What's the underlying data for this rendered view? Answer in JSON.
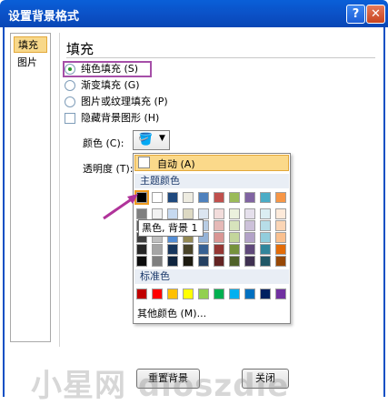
{
  "window": {
    "title": "设置背景格式",
    "help_label": "?",
    "close_label": "✕"
  },
  "nav": {
    "items": [
      {
        "label": "填充"
      },
      {
        "label": "图片"
      }
    ]
  },
  "section": {
    "title": "填充"
  },
  "options": [
    {
      "label": "纯色填充 (S)",
      "type": "radio",
      "checked": true
    },
    {
      "label": "渐变填充 (G)",
      "type": "radio",
      "checked": false
    },
    {
      "label": "图片或纹理填充 (P)",
      "type": "radio",
      "checked": false
    },
    {
      "label": "隐藏背景图形 (H)",
      "type": "checkbox",
      "checked": false
    }
  ],
  "color": {
    "label": "颜色 (C):",
    "icon": "paint-bucket-icon"
  },
  "transparency": {
    "label": "透明度 (T):"
  },
  "palette": {
    "auto_label": "自动 (A)",
    "theme_heading": "主题颜色",
    "theme_top": [
      "#000000",
      "#ffffff",
      "#1f497d",
      "#eeece1",
      "#4f81bd",
      "#c0504d",
      "#9bbb59",
      "#8064a2",
      "#4bacc6",
      "#f79646"
    ],
    "theme_tints": [
      [
        "#7f7f7f",
        "#f2f2f2",
        "#c6d9f0",
        "#ddd9c3",
        "#dbe5f1",
        "#f2dcdb",
        "#ebf1dd",
        "#e5e0ec",
        "#dbeef3",
        "#fdeada"
      ],
      [
        "#595959",
        "#d8d8d8",
        "#8db3e2",
        "#c4bd97",
        "#b8cce4",
        "#e5b9b7",
        "#d7e3bc",
        "#ccc1d9",
        "#b7dde8",
        "#fbd5b5"
      ],
      [
        "#3f3f3f",
        "#bfbfbf",
        "#548dd4",
        "#938953",
        "#95b3d7",
        "#d99694",
        "#c3d69b",
        "#b2a2c7",
        "#92cddc",
        "#fac08f"
      ],
      [
        "#262626",
        "#a5a5a5",
        "#17365d",
        "#494429",
        "#366092",
        "#953734",
        "#76923c",
        "#5f497a",
        "#31859b",
        "#e36c09"
      ],
      [
        "#0c0c0c",
        "#7f7f7f",
        "#0f243e",
        "#1d1b10",
        "#244061",
        "#632423",
        "#4f6128",
        "#3f3151",
        "#205867",
        "#974806"
      ]
    ],
    "standard_heading": "标准色",
    "standard": [
      "#c00000",
      "#ff0000",
      "#ffc000",
      "#ffff00",
      "#92d050",
      "#00b050",
      "#00b0f0",
      "#0070c0",
      "#002060",
      "#7030a0"
    ],
    "more_label": "其他颜色 (M)..."
  },
  "tooltip": {
    "text": "黑色, 背景 1"
  },
  "buttons": {
    "reset": "重置背景",
    "close": "关闭"
  },
  "watermark": "小星网 dioszdie"
}
